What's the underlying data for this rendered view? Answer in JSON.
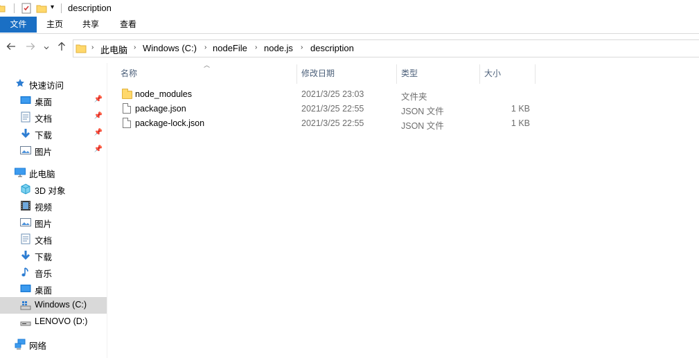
{
  "window": {
    "title": "description"
  },
  "ribbon": {
    "tabs": [
      {
        "label": "文件",
        "active": true
      },
      {
        "label": "主页",
        "active": false
      },
      {
        "label": "共享",
        "active": false
      },
      {
        "label": "查看",
        "active": false
      }
    ],
    "accent": "#1a6fc4"
  },
  "nav": {
    "back_icon": "arrow-left-icon",
    "forward_icon": "arrow-right-icon",
    "recent_icon": "chevron-down-icon",
    "up_icon": "arrow-up-icon",
    "breadcrumb": [
      "此电脑",
      "Windows (C:)",
      "nodeFile",
      "node.js",
      "description"
    ]
  },
  "sidebar": {
    "quick_access": {
      "label": "快速访问",
      "items": [
        {
          "label": "桌面",
          "icon": "desktop-icon",
          "pinned": true
        },
        {
          "label": "文档",
          "icon": "document-icon",
          "pinned": true
        },
        {
          "label": "下载",
          "icon": "download-icon",
          "pinned": true
        },
        {
          "label": "图片",
          "icon": "picture-icon",
          "pinned": true
        }
      ]
    },
    "this_pc": {
      "label": "此电脑",
      "items": [
        {
          "label": "3D 对象",
          "icon": "cube-icon"
        },
        {
          "label": "视频",
          "icon": "video-icon"
        },
        {
          "label": "图片",
          "icon": "picture-icon"
        },
        {
          "label": "文档",
          "icon": "document-icon"
        },
        {
          "label": "下载",
          "icon": "download-icon"
        },
        {
          "label": "音乐",
          "icon": "music-icon"
        },
        {
          "label": "桌面",
          "icon": "desktop-icon"
        },
        {
          "label": "Windows (C:)",
          "icon": "drive-icon",
          "selected": true
        },
        {
          "label": "LENOVO (D:)",
          "icon": "drive-icon"
        }
      ]
    },
    "network": {
      "label": "网络",
      "icon": "network-icon"
    }
  },
  "files": {
    "columns": [
      "名称",
      "修改日期",
      "类型",
      "大小"
    ],
    "rows": [
      {
        "name": "node_modules",
        "modified": "2021/3/25 23:03",
        "type": "文件夹",
        "size": "",
        "icon": "folder-icon"
      },
      {
        "name": "package.json",
        "modified": "2021/3/25 22:55",
        "type": "JSON 文件",
        "size": "1 KB",
        "icon": "file-icon"
      },
      {
        "name": "package-lock.json",
        "modified": "2021/3/25 22:55",
        "type": "JSON 文件",
        "size": "1 KB",
        "icon": "file-icon"
      }
    ]
  }
}
